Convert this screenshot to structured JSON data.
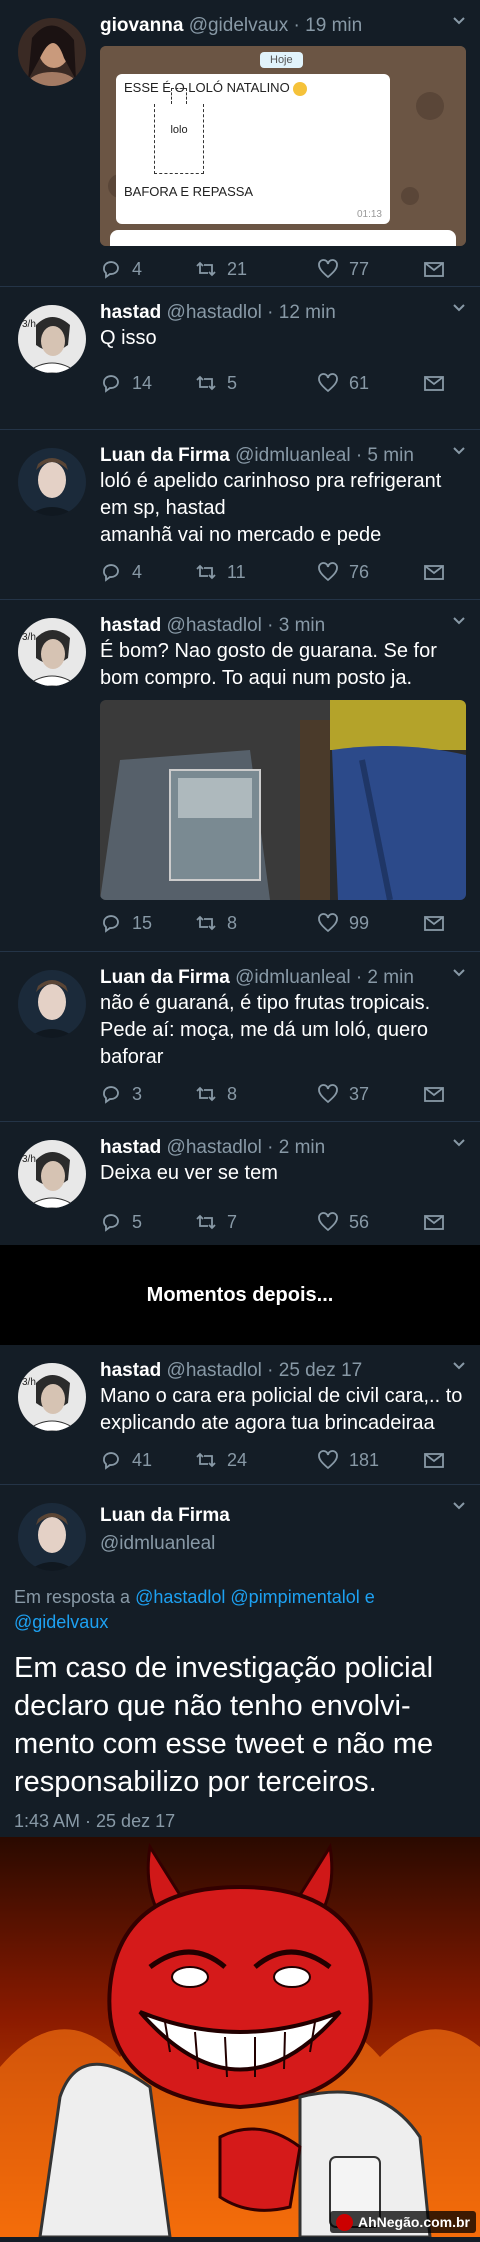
{
  "tweets": [
    {
      "name": "giovanna",
      "handle": "@gidelvaux",
      "time": "· 19 min",
      "replies": "4",
      "retweets": "21",
      "likes": "77",
      "chat": {
        "date": "Hoje",
        "line1": "ESSE É O LOLÓ NATALINO",
        "bottle": "lolo",
        "line2": "BAFORA E REPASSA",
        "time": "01:13"
      }
    },
    {
      "name": "hastad",
      "handle": "@hastadlol",
      "time": "· 12 min",
      "text": [
        "Q isso"
      ],
      "replies": "14",
      "retweets": "5",
      "likes": "61"
    },
    {
      "name": "Luan da Firma",
      "handle": "@idmluanleal",
      "time": "· 5 min",
      "text": [
        "loló é apelido carinhoso pra refrigerant",
        "em sp, hastad",
        "amanhã vai no mercado e pede"
      ],
      "replies": "4",
      "retweets": "11",
      "likes": "76"
    },
    {
      "name": "hastad",
      "handle": "@hastadlol",
      "time": "· 3 min",
      "text": [
        "É bom? Nao gosto de guarana. Se for",
        "bom compro. To aqui num posto ja."
      ],
      "replies": "15",
      "retweets": "8",
      "likes": "99"
    },
    {
      "name": "Luan da Firma",
      "handle": "@idmluanleal",
      "time": "· 2 min",
      "text": [
        "não é guaraná, é tipo frutas tropicais.",
        "Pede aí: moça, me dá um loló, quero",
        "baforar"
      ],
      "replies": "3",
      "retweets": "8",
      "likes": "37"
    },
    {
      "name": "hastad",
      "handle": "@hastadlol",
      "time": "· 2 min",
      "text": [
        "Deixa eu ver se tem"
      ],
      "replies": "5",
      "retweets": "7",
      "likes": "56"
    }
  ],
  "divider": "Momentos depois...",
  "later": {
    "name": "hastad",
    "handle": "@hastadlol",
    "time": "· 25 dez 17",
    "text": [
      "Mano o cara era policial de civil cara,.. to",
      "explicando ate agora tua brincadeiraa"
    ],
    "replies": "41",
    "retweets": "24",
    "likes": "181"
  },
  "detail": {
    "name": "Luan da Firma",
    "handle": "@idmluanleal",
    "reply_prefix": "Em resposta a",
    "reply_to": "@hastadlol @pimpimentalol e",
    "reply_to2": "@gidelvaux",
    "text": [
      "Em caso de investigação policial",
      "declaro que não tenho envolvi-",
      "mento com esse tweet e não me",
      "responsabilizo por terceiros."
    ],
    "stamp": "1:43 AM · 25 dez 17"
  },
  "watermark": "AhNegão.com.br",
  "colors": {
    "bg": "#141d26",
    "muted": "#8899a6",
    "link": "#1da1f2"
  }
}
